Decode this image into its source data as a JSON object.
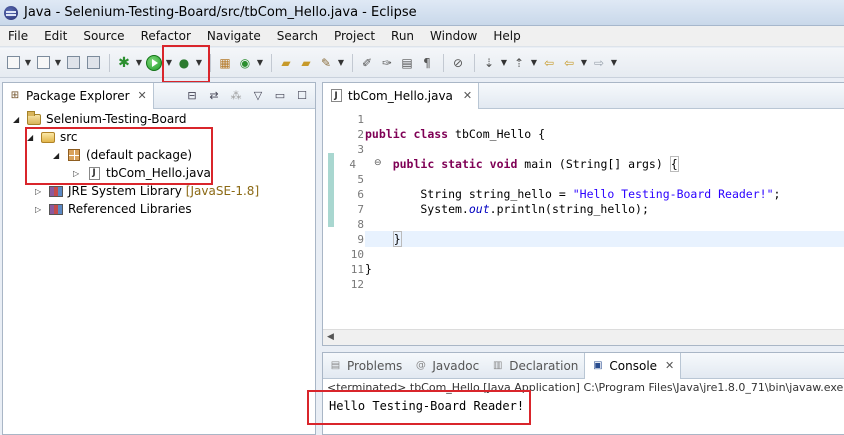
{
  "window": {
    "title": "Java - Selenium-Testing-Board/src/tbCom_Hello.java - Eclipse"
  },
  "menu": [
    "File",
    "Edit",
    "Source",
    "Refactor",
    "Navigate",
    "Search",
    "Project",
    "Run",
    "Window",
    "Help"
  ],
  "package_explorer": {
    "tab_label": "Package Explorer",
    "tree": {
      "project": "Selenium-Testing-Board",
      "src": "src",
      "package": "(default package)",
      "file": "tbCom_Hello.java",
      "jre_label": "JRE System Library",
      "jre_version": "[JavaSE-1.8]",
      "libs": "Referenced Libraries"
    }
  },
  "editor": {
    "tab_label": "tbCom_Hello.java",
    "line_numbers": [
      "1",
      "2",
      "3",
      "4",
      "5",
      "6",
      "7",
      "8",
      "9",
      "10",
      "11",
      "12"
    ]
  },
  "console": {
    "tabs": {
      "problems": "Problems",
      "javadoc": "Javadoc",
      "declaration": "Declaration",
      "console": "Console"
    },
    "status": "<terminated> tbCom_Hello [Java Application] C:\\Program Files\\Java\\jre1.8.0_71\\bin\\javaw.exe (29",
    "output": "Hello Testing-Board Reader!"
  },
  "icons": {
    "run": "run-icon",
    "debug": "debug-icon"
  }
}
